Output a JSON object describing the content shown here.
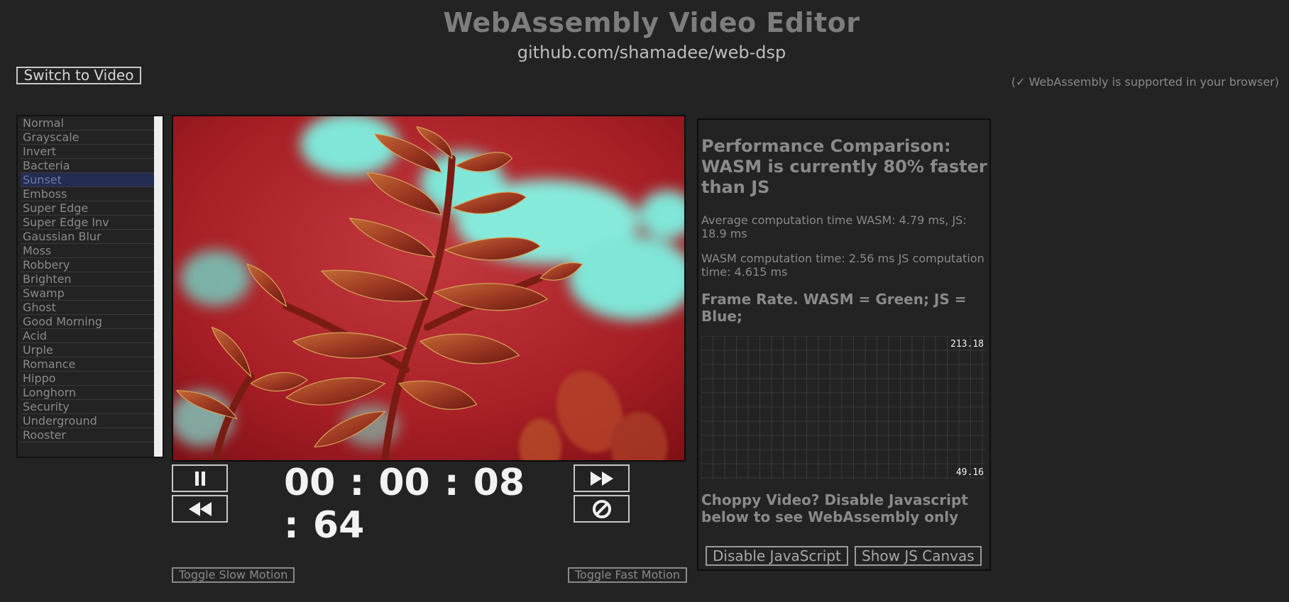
{
  "header": {
    "title": "WebAssembly Video Editor",
    "subtitle": "github.com/shamadee/web-dsp",
    "switch_button": "Switch to Video",
    "support_message": "(✓ WebAssembly is supported in your browser)"
  },
  "filters": {
    "selected": "Sunset",
    "items": [
      "Normal",
      "Grayscale",
      "Invert",
      "Bacteria",
      "Sunset",
      "Emboss",
      "Super Edge",
      "Super Edge Inv",
      "Gaussian Blur",
      "Moss",
      "Robbery",
      "Brighten",
      "Swamp",
      "Ghost",
      "Good Morning",
      "Acid",
      "Urple",
      "Romance",
      "Hippo",
      "Longhorn",
      "Security",
      "Underground",
      "Rooster"
    ]
  },
  "video": {
    "timecode": "00 : 00 : 08 : 64",
    "controls": {
      "pause_icon": "pause-icon",
      "rewind_icon": "rewind-icon",
      "fast_forward_icon": "fast-forward-icon",
      "stop_icon": "cancel-icon"
    },
    "toggle_slow": "Toggle Slow Motion",
    "toggle_fast": "Toggle Fast Motion"
  },
  "performance": {
    "heading": "Performance Comparison: WASM is currently 80% faster than JS",
    "average_text": "Average computation time WASM: 4.79 ms, JS: 18.9 ms",
    "current_text": "WASM computation time: 2.56 ms JS computation time: 4.615 ms",
    "fps_heading": "Frame Rate. WASM = Green; JS = Blue;",
    "fps_max": "213.18",
    "fps_min": "49.16",
    "choppy_text": "Choppy Video? Disable Javascript below to see WebAssembly only",
    "disable_js_button": "Disable JavaScript",
    "show_canvas_button": "Show JS Canvas"
  },
  "colors": {
    "background": "#232323",
    "selected_filter": "#232c50",
    "scroll_accent": "#c0531f"
  }
}
